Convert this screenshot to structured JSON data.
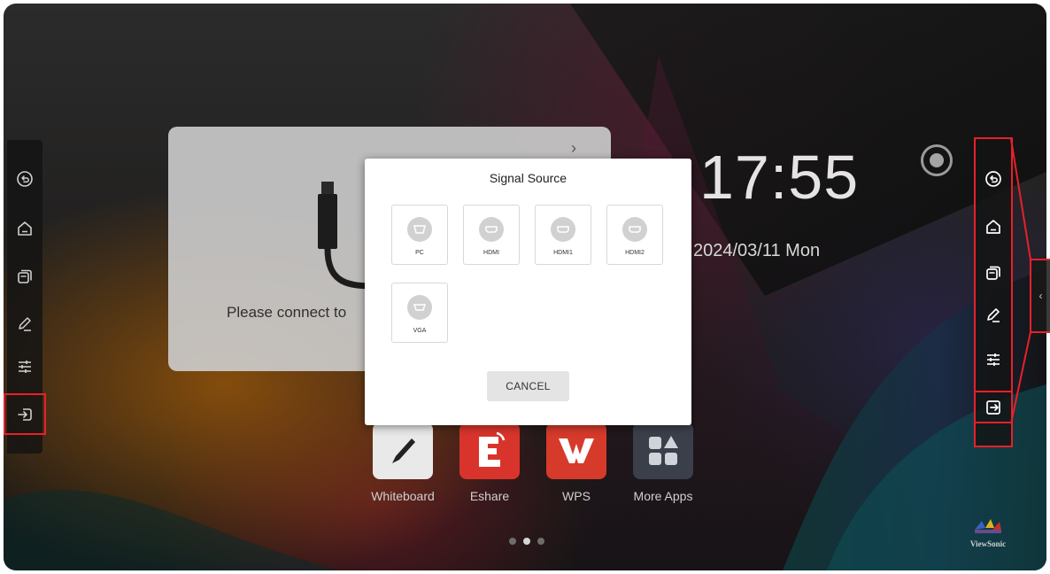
{
  "home": {
    "clock": "17:55",
    "date": "2024/03/11 Mon",
    "card_message": "Please connect to"
  },
  "left_toolbar": {
    "items": [
      {
        "icon": "back-icon"
      },
      {
        "icon": "home-icon"
      },
      {
        "icon": "multitask-icon"
      },
      {
        "icon": "annotate-pen-icon"
      },
      {
        "icon": "settings-sliders-icon"
      },
      {
        "icon": "input-source-icon",
        "highlighted": true
      }
    ]
  },
  "right_toolbar": {
    "items": [
      {
        "icon": "back-icon"
      },
      {
        "icon": "home-icon"
      },
      {
        "icon": "multitask-icon"
      },
      {
        "icon": "annotate-pen-icon"
      },
      {
        "icon": "settings-sliders-icon"
      },
      {
        "icon": "input-source-icon",
        "highlighted": true
      }
    ],
    "collapse_handle": "‹"
  },
  "apps": [
    {
      "label": "Whiteboard",
      "icon": "whiteboard-pen-icon",
      "color": "#e9e9e9"
    },
    {
      "label": "Eshare",
      "icon": "eshare-icon",
      "color": "#d9342b"
    },
    {
      "label": "WPS",
      "icon": "wps-icon",
      "color": "#d63a2b"
    },
    {
      "label": "More Apps",
      "icon": "more-apps-grid-icon",
      "color": "#3b3f4a"
    }
  ],
  "page_indicator": {
    "count": 3,
    "current": 2
  },
  "brand": {
    "label": "ViewSonic"
  },
  "dialog": {
    "title": "Signal Source",
    "sources": [
      {
        "label": "PC",
        "icon": "pc-port-icon"
      },
      {
        "label": "HDMI",
        "icon": "hdmi-port-icon"
      },
      {
        "label": "HDMI1",
        "icon": "hdmi-port-icon"
      },
      {
        "label": "HDMI2",
        "icon": "hdmi-port-icon"
      },
      {
        "label": "VGA",
        "icon": "vga-port-icon"
      }
    ],
    "cancel_label": "CANCEL"
  },
  "colors": {
    "highlight": "#e8202a",
    "dialog_bg": "#ffffff",
    "toolbar_bg": "#141414"
  }
}
